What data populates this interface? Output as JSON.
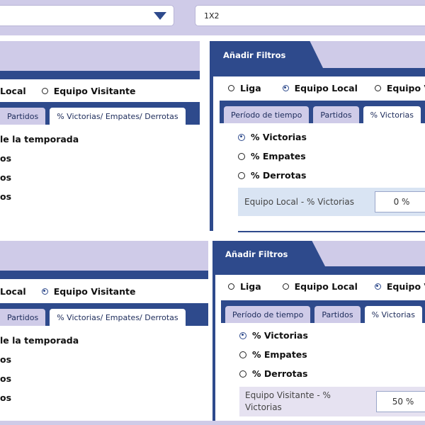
{
  "top": {
    "dropdown_left_value": "",
    "dropdown_right_value": "1X2"
  },
  "left_top": {
    "radio_local": "Local",
    "radio_visitante": "Equipo Visitante",
    "tabs": [
      "Partidos",
      "% Victorias/ Empates/ Derrotas"
    ],
    "lines": [
      "le la temporada",
      "os",
      "os",
      "os"
    ]
  },
  "left_bottom": {
    "radio_local": "Local",
    "radio_visitante": "Equipo Visitante",
    "tabs": [
      "Partidos",
      "% Victorias/ Empates/ Derrotas"
    ],
    "lines": [
      "le la temporada",
      "os",
      "os",
      "os"
    ]
  },
  "right_top": {
    "header": "Añadir Filtros",
    "radios": [
      "Liga",
      "Equipo Local",
      "Equipo V"
    ],
    "tabs": [
      "Período de tiempo",
      "Partidos",
      "% Victorias"
    ],
    "options": [
      "% Victorias",
      "% Empates",
      "% Derrotas"
    ],
    "field_label": "Equipo Local - % Victorias",
    "field_value": "0 %"
  },
  "right_bottom": {
    "header": "Añadir Filtros",
    "radios": [
      "Liga",
      "Equipo Local",
      "Equipo V"
    ],
    "tabs": [
      "Período de tiempo",
      "Partidos",
      "% Victorias"
    ],
    "options": [
      "% Victorias",
      "% Empates",
      "% Derrotas"
    ],
    "field_label_line1": "Equipo Visitante - %",
    "field_label_line2": "Victorias",
    "field_value": "50 %"
  }
}
